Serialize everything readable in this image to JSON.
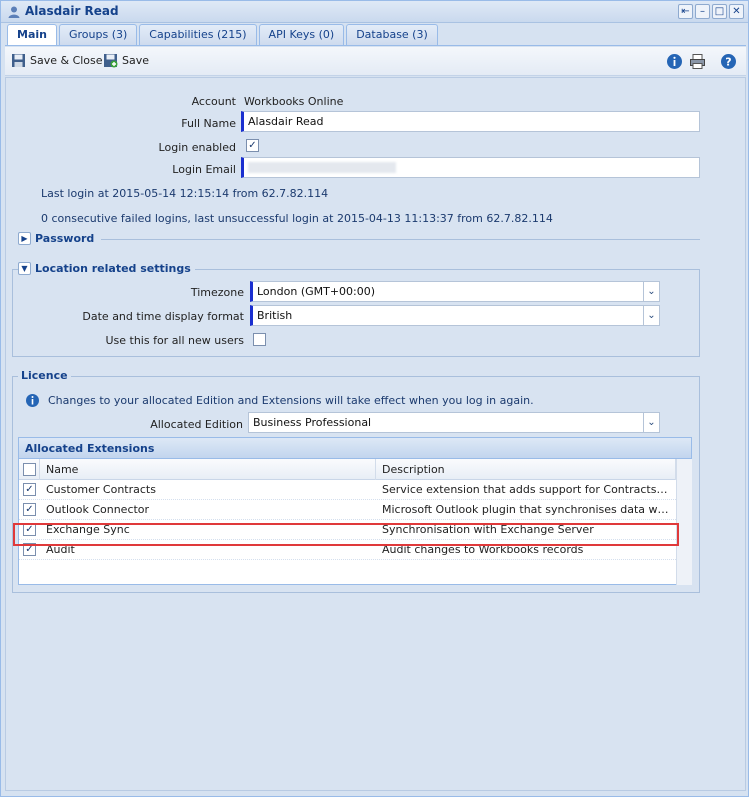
{
  "window": {
    "title": "Alasdair Read",
    "controls": [
      "restore-icon",
      "minimize-icon",
      "maximize-icon",
      "close-icon"
    ]
  },
  "tabs": [
    {
      "label": "Main",
      "active": true
    },
    {
      "label": "Groups (3)"
    },
    {
      "label": "Capabilities (215)"
    },
    {
      "label": "API Keys (0)"
    },
    {
      "label": "Database (3)"
    }
  ],
  "toolbar": {
    "save_close_label": "Save & Close",
    "save_label": "Save",
    "right_icons": [
      "info-icon",
      "print-icon",
      "help-icon"
    ]
  },
  "form": {
    "account_label": "Account",
    "account_value": "Workbooks Online",
    "full_name_label": "Full Name",
    "full_name_value": "Alasdair Read",
    "login_enabled_label": "Login enabled",
    "login_enabled_checked": true,
    "login_email_label": "Login Email",
    "login_email_value": "",
    "last_login": "Last login at 2015-05-14 12:15:14 from 62.7.82.114",
    "failed_logins": "0 consecutive failed logins, last unsuccessful login at 2015-04-13 11:13:37 from 62.7.82.114"
  },
  "password_section": {
    "title": "Password"
  },
  "location_section": {
    "title": "Location related settings",
    "timezone_label": "Timezone",
    "timezone_value": "London (GMT+00:00)",
    "date_format_label": "Date and time display format",
    "date_format_value": "British",
    "use_for_new_label": "Use this for all new users"
  },
  "licence": {
    "title": "Licence",
    "notice": "Changes to your allocated Edition and Extensions will take effect when you log in again.",
    "edition_label": "Allocated Edition",
    "edition_value": "Business Professional",
    "extensions_title": "Allocated Extensions",
    "columns": [
      "Name",
      "Description"
    ],
    "rows": [
      {
        "name": "Customer Contracts",
        "description": "Service extension that adds support for Contracts for cu...",
        "checked": true
      },
      {
        "name": "Outlook Connector",
        "description": "Microsoft Outlook plugin that synchronises data with the ...",
        "checked": true
      },
      {
        "name": "Exchange Sync",
        "description": "Synchronisation with Exchange Server",
        "checked": true,
        "highlighted": true
      },
      {
        "name": "Audit",
        "description": "Audit changes to Workbooks records",
        "checked": true
      }
    ]
  },
  "colors": {
    "accent": "#15428b",
    "highlight": "#e0393a",
    "field_marker": "#1a2fd0"
  }
}
